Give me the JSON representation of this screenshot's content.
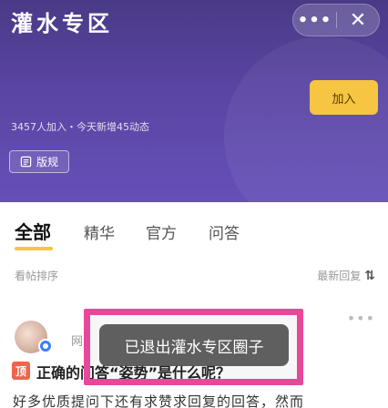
{
  "header": {
    "title": "灌水专区",
    "more_label": "•••",
    "close_label": "✕",
    "join_label": "加入",
    "stats": "3457人加入・今天新增45动态",
    "rules_label": "版规"
  },
  "tabs": [
    {
      "label": "全部",
      "active": true
    },
    {
      "label": "精华",
      "active": false
    },
    {
      "label": "官方",
      "active": false
    },
    {
      "label": "问答",
      "active": false
    }
  ],
  "sort": {
    "left_label": "看帖排序",
    "right_label": "最新回复",
    "right_icon": "⇅"
  },
  "post": {
    "menu_label": "•••",
    "author_fragment": "网",
    "pin_label": "顶",
    "title": "正确的问答“姿势”是什么呢？",
    "excerpt": "好多优质提问下还有求赞求回复的回答，然而"
  },
  "toast": {
    "message": "已退出灌水专区圈子"
  },
  "colors": {
    "header_top": "#4a3a86",
    "header_bottom": "#6650b8",
    "accent_yellow": "#f6c542",
    "highlight_pink": "#e8489a",
    "pin_red": "#f0644b"
  }
}
